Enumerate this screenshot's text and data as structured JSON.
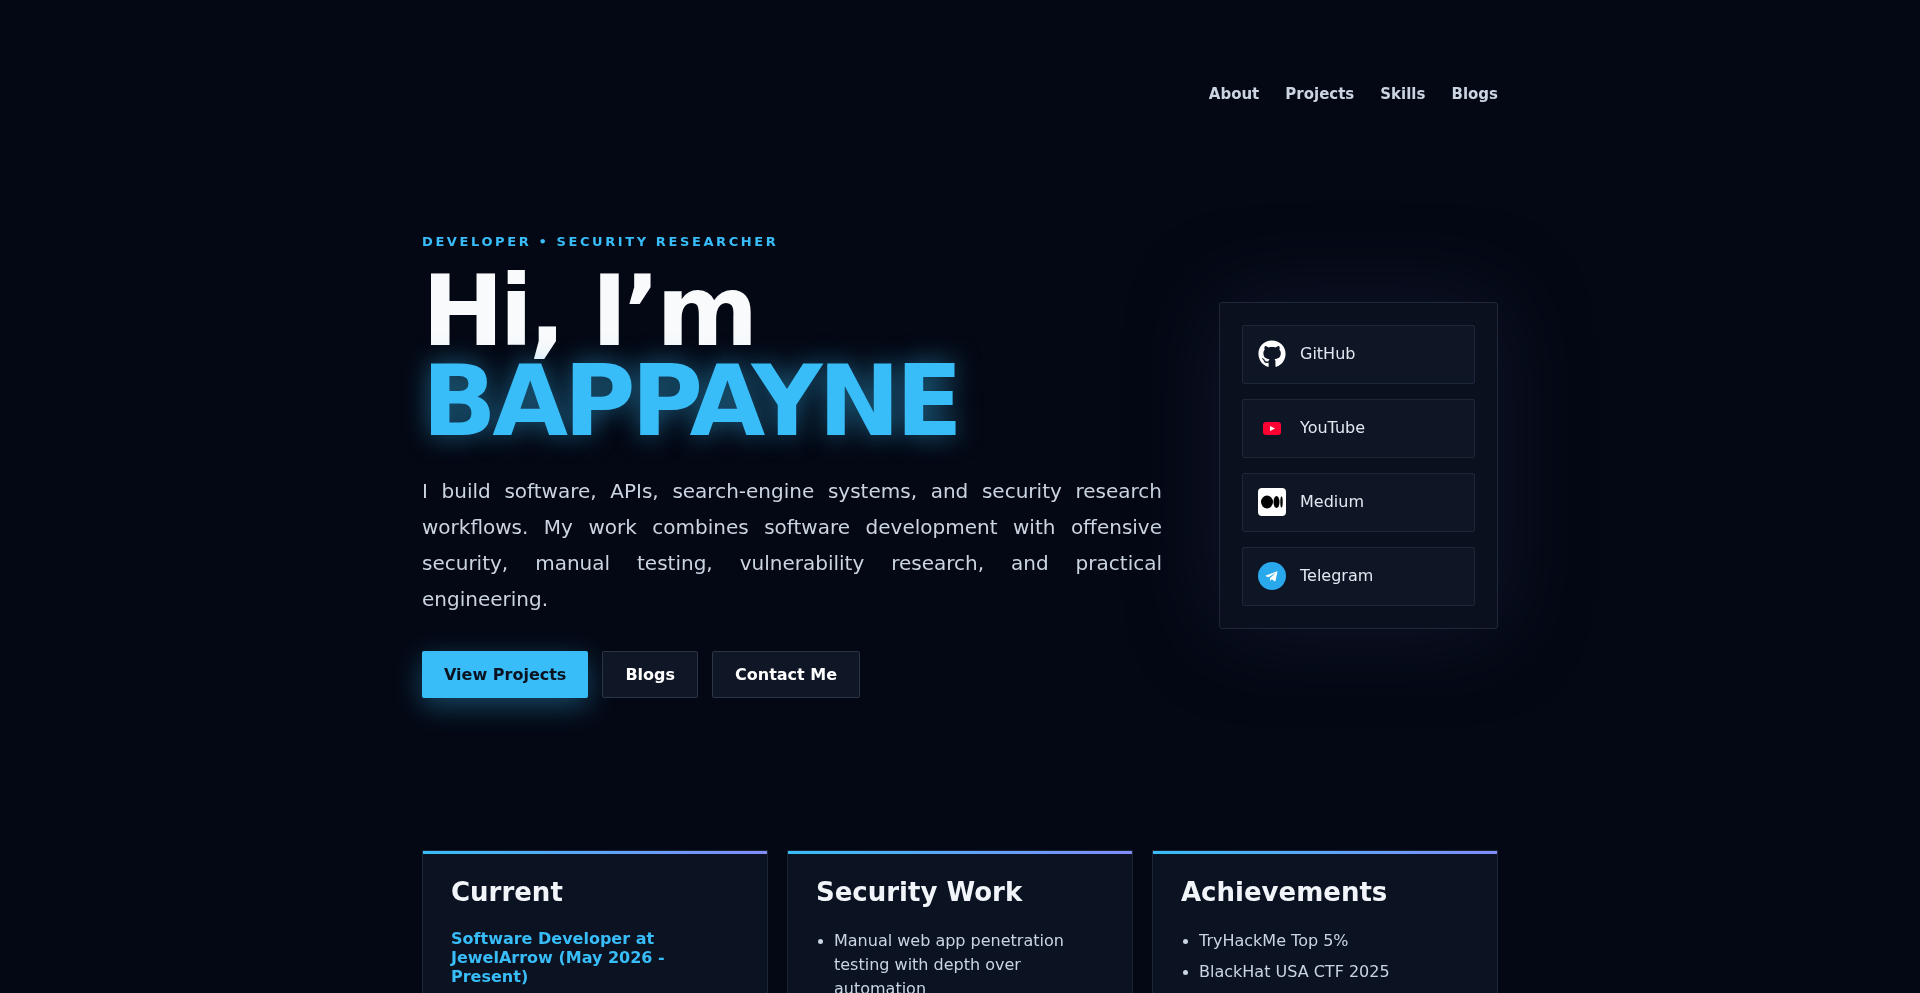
{
  "nav": {
    "links": [
      "About",
      "Projects",
      "Skills",
      "Blogs"
    ]
  },
  "hero": {
    "eyebrow": "DEVELOPER • SECURITY RESEARCHER",
    "greeting": "Hi, I’m",
    "name": "BAPPAYNE",
    "intro": "I build software, APIs, search-engine systems, and security research workflows. My work combines software development with offensive security, manual testing, vulnerability research, and practical engineering.",
    "buttons": [
      {
        "label": "View Projects",
        "kind": "primary"
      },
      {
        "label": "Blogs",
        "kind": "secondary"
      },
      {
        "label": "Contact Me",
        "kind": "secondary"
      }
    ]
  },
  "social_links": [
    {
      "label": "GitHub",
      "kind": "github"
    },
    {
      "label": "YouTube",
      "kind": "youtube"
    },
    {
      "label": "Medium",
      "kind": "medium"
    },
    {
      "label": "Telegram",
      "kind": "telegram"
    }
  ],
  "cards": [
    {
      "title": "Current",
      "kind": "role",
      "role": "Software Developer at JewelArrow (May 2026 - Present)"
    },
    {
      "title": "Security Work",
      "kind": "list",
      "items": [
        "Manual web app penetration testing with depth over automation"
      ]
    },
    {
      "title": "Achievements",
      "kind": "list",
      "items": [
        "TryHackMe Top 5%",
        "BlackHat USA CTF 2025"
      ]
    }
  ]
}
